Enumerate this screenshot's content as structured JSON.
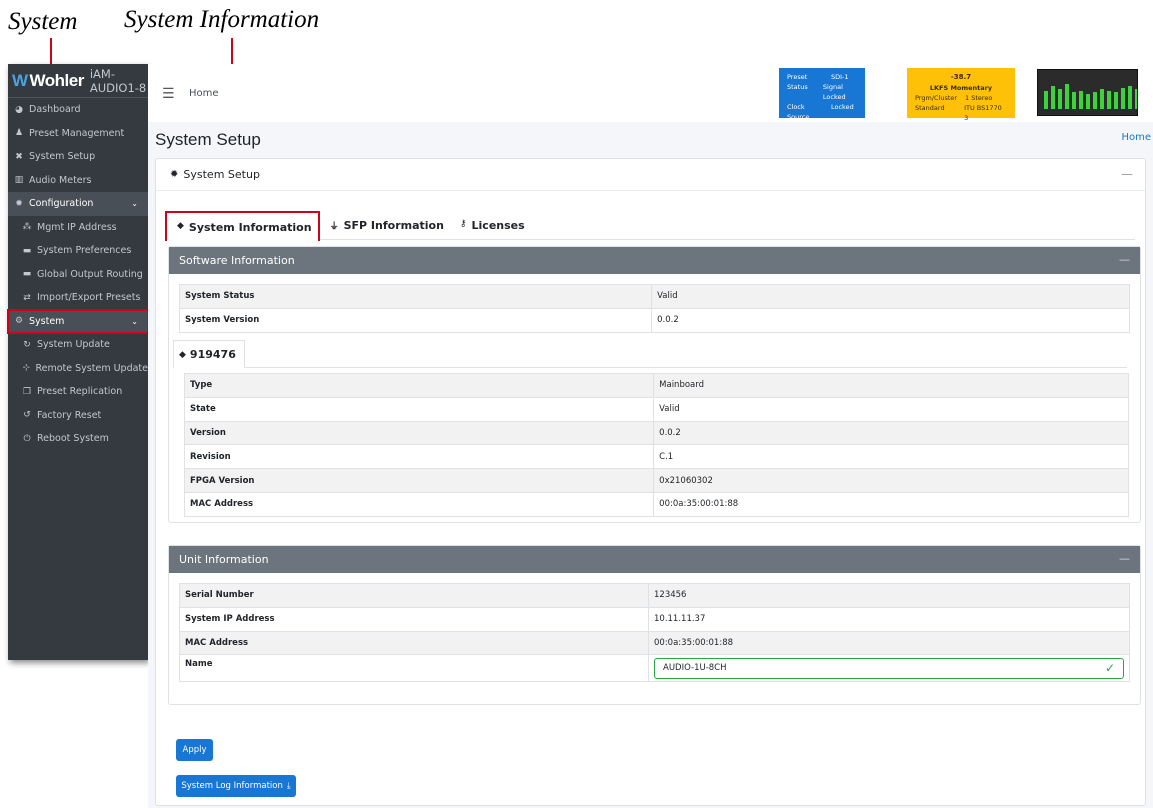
{
  "callouts": {
    "system": "System",
    "system_information": "System Information"
  },
  "sidebar": {
    "brand": "Wohler",
    "model": "iAM-AUDIO1-8",
    "items": [
      {
        "label": "Dashboard",
        "icon": "dashboard-icon"
      },
      {
        "label": "Preset Management",
        "icon": "users-icon"
      },
      {
        "label": "System Setup",
        "icon": "tools-icon"
      },
      {
        "label": "Audio Meters",
        "icon": "chart-icon"
      },
      {
        "label": "Configuration",
        "icon": "gear-icon"
      },
      {
        "label": "Mgmt IP Address",
        "icon": "network-icon"
      },
      {
        "label": "System Preferences",
        "icon": "keyboard-icon"
      },
      {
        "label": "Global Output Routing",
        "icon": "keyboard-icon"
      },
      {
        "label": "Import/Export Presets",
        "icon": "exchange-icon"
      },
      {
        "label": "System",
        "icon": "cogs-icon"
      },
      {
        "label": "System Update",
        "icon": "sync-icon"
      },
      {
        "label": "Remote System Update",
        "icon": "network-wired-icon"
      },
      {
        "label": "Preset Replication",
        "icon": "clone-icon"
      },
      {
        "label": "Factory Reset",
        "icon": "undo-icon"
      },
      {
        "label": "Reboot System",
        "icon": "power-icon"
      }
    ]
  },
  "topbar": {
    "home": "Home",
    "status_blue": [
      {
        "k": "Preset",
        "v": "SDI-1"
      },
      {
        "k": "Status",
        "v": "Signal Locked"
      },
      {
        "k": "Clock Source",
        "v": "Locked"
      }
    ],
    "status_yellow": {
      "value": "-38.7",
      "mode": "LKFS  Momentary",
      "rows": [
        {
          "k": "Prgm/Cluster",
          "v": "1  Stereo"
        },
        {
          "k": "Standard",
          "v": "ITU BS1770 3"
        }
      ]
    },
    "meter_levels": [
      0.55,
      0.7,
      0.6,
      0.75,
      0.5,
      0.55,
      0.45,
      0.5,
      0.6,
      0.55,
      0.5,
      0.65,
      0.7,
      0.6
    ]
  },
  "page": {
    "title": "System Setup",
    "breadcrumb": "Home",
    "card_title": "System Setup"
  },
  "tabs": [
    {
      "label": "System Information",
      "icon": "tag-icon"
    },
    {
      "label": "SFP Information",
      "icon": "plug-icon"
    },
    {
      "label": "Licenses",
      "icon": "key-icon"
    }
  ],
  "software": {
    "title": "Software Information",
    "rows": [
      {
        "key": "System Status",
        "value": "Valid"
      },
      {
        "key": "System Version",
        "value": "0.0.2"
      }
    ],
    "module_tab": "919476",
    "module_rows": [
      {
        "key": "Type",
        "value": "Mainboard"
      },
      {
        "key": "State",
        "value": "Valid"
      },
      {
        "key": "Version",
        "value": "0.0.2"
      },
      {
        "key": "Revision",
        "value": "C.1"
      },
      {
        "key": "FPGA Version",
        "value": "0x21060302"
      },
      {
        "key": "MAC Address",
        "value": "00:0a:35:00:01:88"
      }
    ]
  },
  "unit": {
    "title": "Unit Information",
    "rows": [
      {
        "key": "Serial Number",
        "value": "123456"
      },
      {
        "key": "System IP Address",
        "value": "10.11.11.37"
      },
      {
        "key": "MAC Address",
        "value": "00:0a:35:00:01:88"
      }
    ],
    "name_label": "Name",
    "name_value": "AUDIO-1U-8CH"
  },
  "buttons": {
    "apply": "Apply",
    "log": "System Log Information"
  }
}
